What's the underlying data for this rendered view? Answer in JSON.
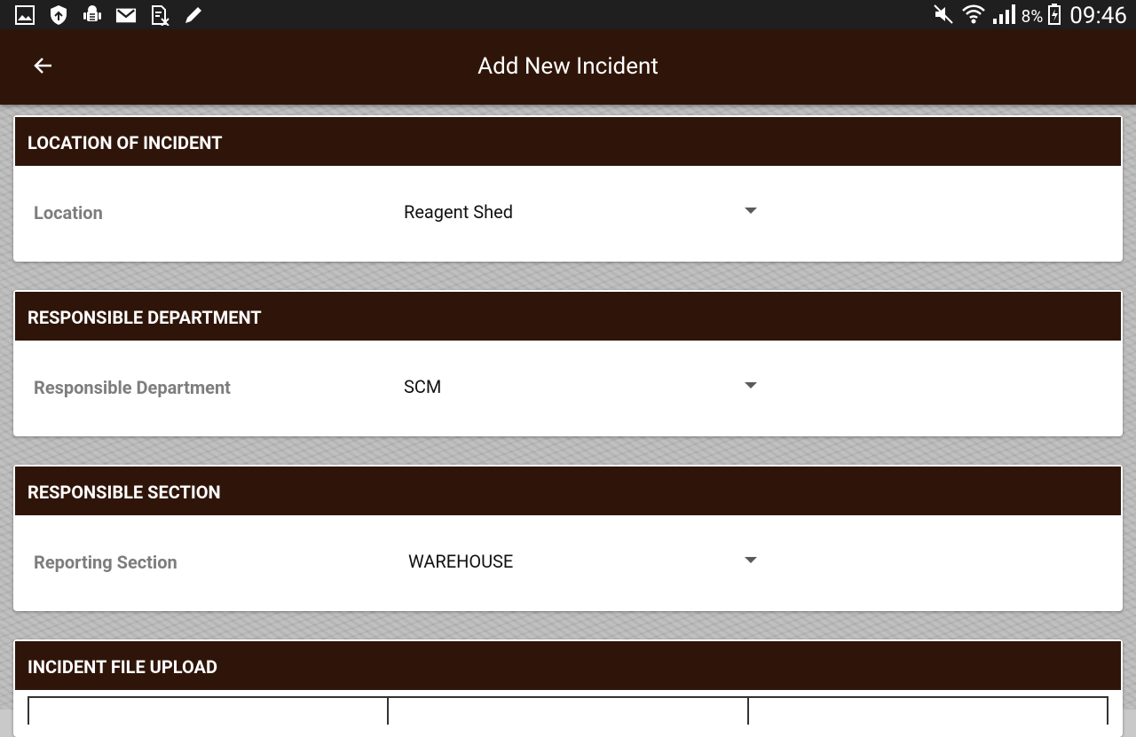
{
  "status_bar": {
    "notification_icons": [
      "gallery-icon",
      "shield-update-icon",
      "android-debug-icon",
      "gmail-icon",
      "document-edit-icon",
      "pencil-icon"
    ],
    "battery_percent": "8%",
    "time": "09:46"
  },
  "app_bar": {
    "title": "Add New Incident",
    "back_icon": "arrow-back-icon"
  },
  "sections": {
    "location": {
      "header": "LOCATION OF INCIDENT",
      "field_label": "Location",
      "selected_value": "Reagent Shed"
    },
    "department": {
      "header": "RESPONSIBLE DEPARTMENT",
      "field_label": "Responsible Department",
      "selected_value": "SCM"
    },
    "section": {
      "header": "RESPONSIBLE SECTION",
      "field_label": "Reporting Section",
      "selected_value": "WAREHOUSE"
    },
    "upload": {
      "header": "INCIDENT FILE UPLOAD"
    }
  },
  "colors": {
    "app_bar": "#2f1509",
    "section_header": "#2f1509",
    "status_bar": "#1f1f1f",
    "label_text": "#7d7d7d"
  }
}
